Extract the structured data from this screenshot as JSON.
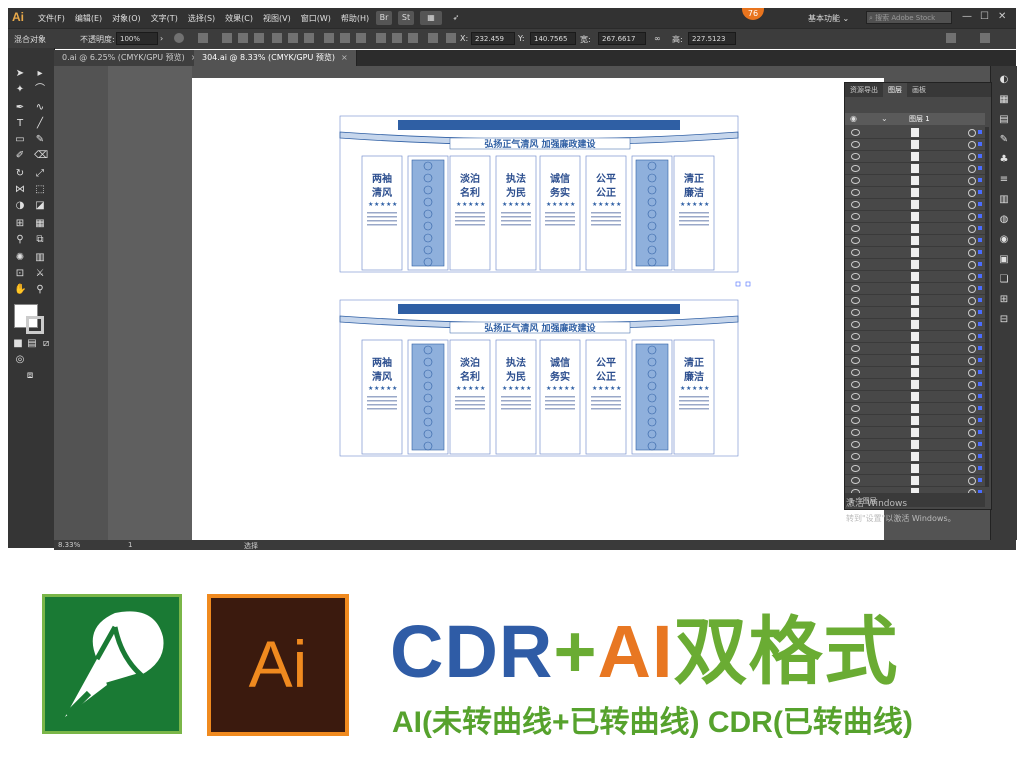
{
  "app": {
    "logo": "Ai",
    "badge": "76",
    "workspace": "基本功能",
    "search_placeholder": "搜索 Adobe Stock"
  },
  "menu": [
    "文件(F)",
    "编辑(E)",
    "对象(O)",
    "文字(T)",
    "选择(S)",
    "效果(C)",
    "视图(V)",
    "窗口(W)",
    "帮助(H)"
  ],
  "control": {
    "object_label": "混合对象",
    "opacity_label": "不透明度:",
    "opacity_value": "100%",
    "x_label": "X:",
    "x_value": "232.459",
    "y_label": "Y:",
    "y_value": "140.7565",
    "w_label": "宽:",
    "w_value": "267.6617",
    "h_label": "高:",
    "h_value": "227.5123"
  },
  "tabs": [
    {
      "label": "0.ai @ 6.25% (CMYK/GPU 预览)",
      "close": "×"
    },
    {
      "label": "304.ai @ 8.33% (CMYK/GPU 预览)",
      "close": "×"
    }
  ],
  "status": {
    "zoom": "8.33%",
    "page": "1",
    "mode": "选择"
  },
  "layers_panel": {
    "tabs": [
      "资源导出",
      "图层",
      "画板"
    ],
    "layer_name": "图层 1",
    "footer": "1 个图层"
  },
  "windows_watermark": {
    "line1": "激活 Windows",
    "line2": "转到\"设置\"以激活 Windows。"
  },
  "design": {
    "banner": "弘扬正气清风  加强廉政建设",
    "panels": [
      "两袖清风",
      "淡泊名利",
      "执法为民",
      "诚信务实",
      "公平公正",
      "清正廉洁"
    ]
  },
  "promo": {
    "headline_a": "CDR",
    "headline_plus": "+",
    "headline_b": "AI",
    "headline_c": "双格式",
    "subtitle": "AI(未转曲线+已转曲线) CDR(已转曲线)",
    "ai_logo_text": "Ai"
  }
}
